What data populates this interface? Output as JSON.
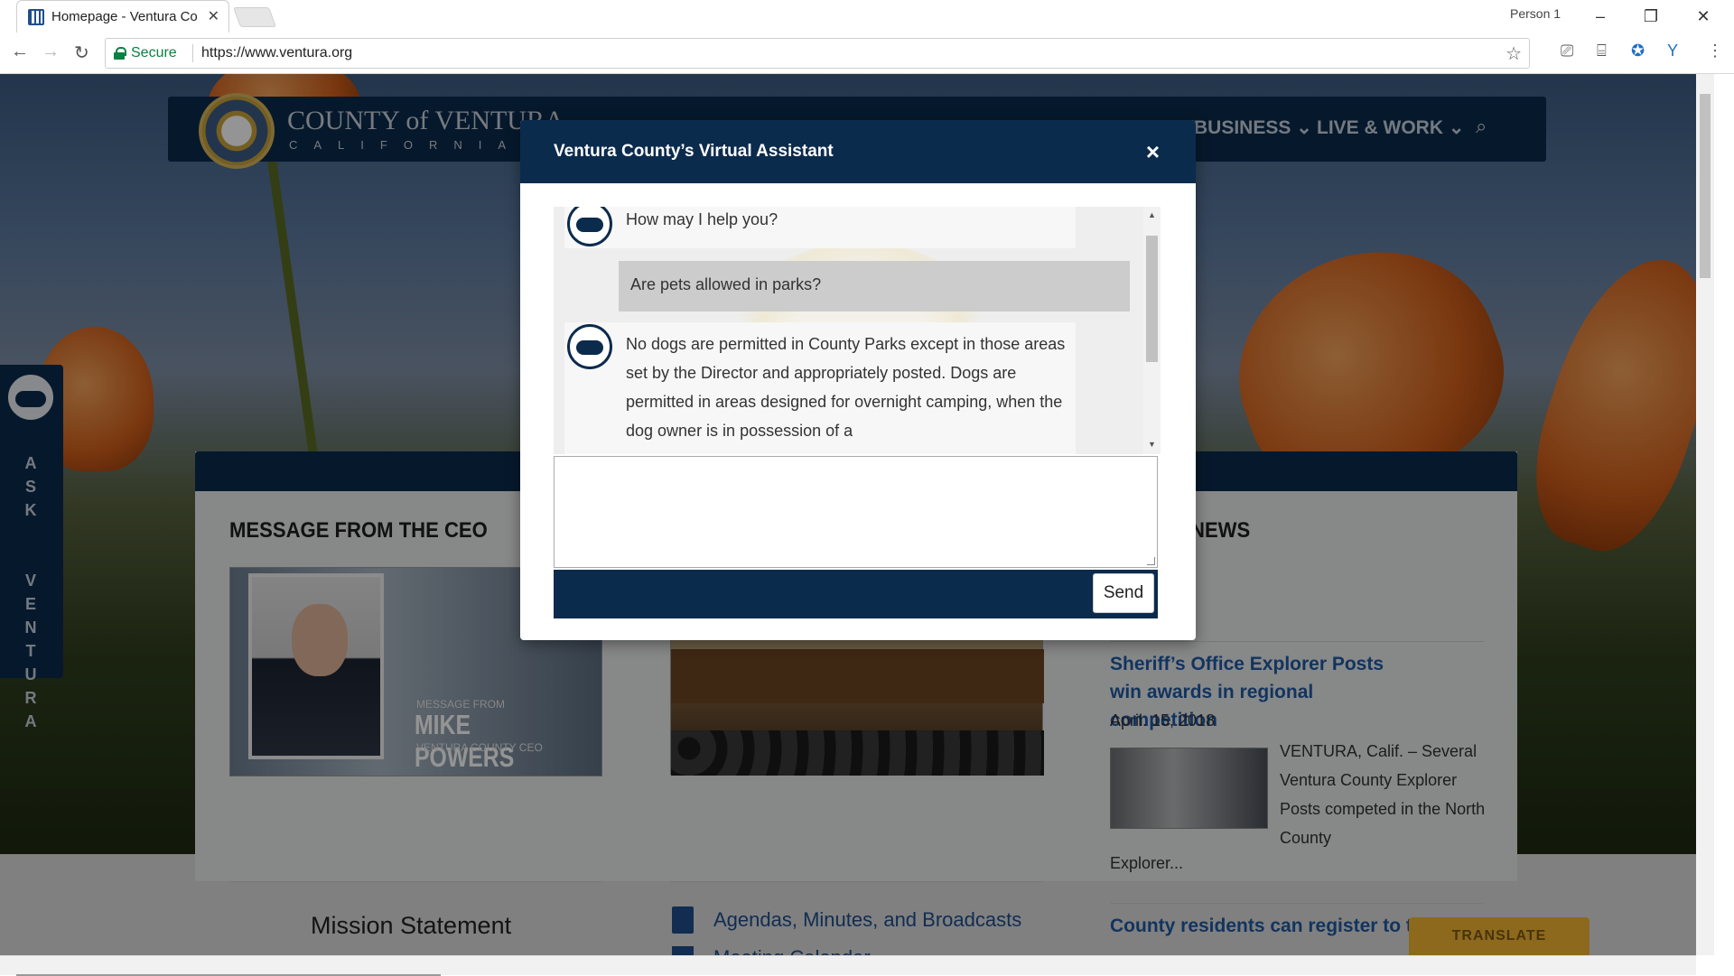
{
  "browser": {
    "tab_title": "Homepage - Ventura Co",
    "profile": "Person 1",
    "secure_label": "Secure",
    "url": "https://www.ventura.org"
  },
  "site": {
    "logo_line1": "COUNTY of VENTURA",
    "logo_line2": "CALIFORNIA",
    "nav": [
      {
        "label": "BUSINESS ⌄"
      },
      {
        "label": "LIVE & WORK ⌄"
      }
    ],
    "ask_ventura": "ASK VENTURA",
    "ceo_heading": "MESSAGE FROM THE CEO",
    "ceo_caption_top": "MESSAGE FROM",
    "ceo_caption_name": "MIKE POWERS",
    "ceo_caption_title": "VENTURA COUNTY CEO",
    "news_heading": "NEWS",
    "mission": "Mission Statement",
    "agendas": "Agendas, Minutes, and Broadcasts",
    "meeting_calendar": "Meeting Calendar",
    "news": [
      {
        "title": "Sheriff’s Office Explorer Posts win awards in regional competition",
        "date": "April. 15, 2018",
        "excerpt": "VENTURA, Calif. – Several Ventura County Explorer Posts competed in the North County",
        "excerpt_tail": "Explorer..."
      },
      {
        "title": "County residents can register to text"
      }
    ],
    "translate": "TRANSLATE"
  },
  "assistant": {
    "title": "Ventura County’s Virtual Assistant",
    "close": "×",
    "messages": [
      {
        "from": "bot",
        "text": "How may I help you?"
      },
      {
        "from": "user",
        "text": "Are pets allowed in parks?"
      },
      {
        "from": "bot",
        "text": "No dogs are permitted in County Parks except in those areas set by the Director and appropriately posted. Dogs are permitted in areas designed for overnight camping, when the dog owner is in possession of a"
      }
    ],
    "input_value": "",
    "send_label": "Send"
  }
}
